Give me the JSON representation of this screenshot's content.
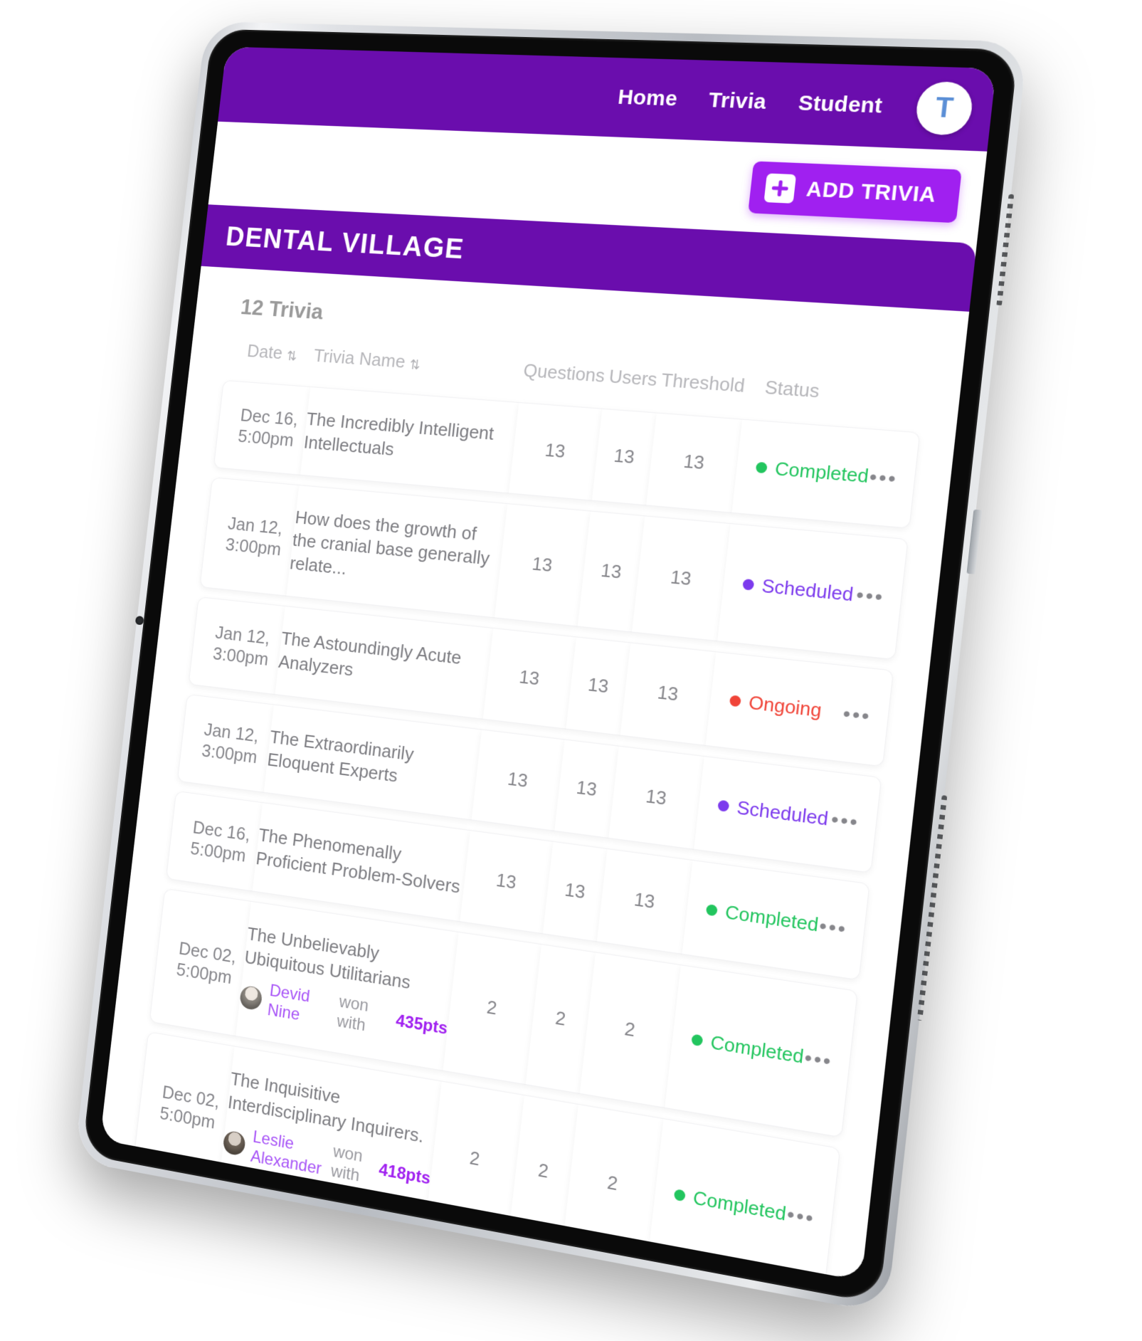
{
  "app": {
    "brand_purple": "#6a0dad",
    "accent_purple": "#a020f0",
    "title": "DENTAL VILLAGE"
  },
  "topbar": {
    "nav": [
      {
        "label": "Home"
      },
      {
        "label": "Trivia"
      },
      {
        "label": "Student"
      }
    ],
    "avatar_initial": "T"
  },
  "actions": {
    "add_trivia_label": "ADD TRIVIA",
    "add_icon": "plus-icon"
  },
  "list": {
    "count_label": "12 Trivia",
    "columns": [
      {
        "key": "date",
        "label": "Date",
        "sortable": true
      },
      {
        "key": "name",
        "label": "Trivia Name",
        "sortable": true
      },
      {
        "key": "questions",
        "label": "Questions",
        "sortable": false
      },
      {
        "key": "users",
        "label": "Users",
        "sortable": false
      },
      {
        "key": "threshold",
        "label": "Threshold",
        "sortable": false
      },
      {
        "key": "status",
        "label": "Status",
        "sortable": false
      }
    ],
    "sort_glyph": "⇅",
    "kebab_glyph": "•••",
    "status_colors": {
      "Completed": "#22c55e",
      "Scheduled": "#7c3aed",
      "Ongoing": "#f04438"
    },
    "rows": [
      {
        "date": "Dec 16, 5:00pm",
        "name": "The Incredibly Intelligent Intellectuals",
        "questions": "13",
        "users": "13",
        "threshold": "13",
        "status": "Completed",
        "winner": null
      },
      {
        "date": "Jan 12, 3:00pm",
        "name": "How does the growth of the cranial base generally relate...",
        "questions": "13",
        "users": "13",
        "threshold": "13",
        "status": "Scheduled",
        "winner": null
      },
      {
        "date": "Jan 12, 3:00pm",
        "name": "The Astoundingly Acute Analyzers",
        "questions": "13",
        "users": "13",
        "threshold": "13",
        "status": "Ongoing",
        "winner": null
      },
      {
        "date": "Jan 12, 3:00pm",
        "name": "The Extraordinarily Eloquent Experts",
        "questions": "13",
        "users": "13",
        "threshold": "13",
        "status": "Scheduled",
        "winner": null
      },
      {
        "date": "Dec 16, 5:00pm",
        "name": "The Phenomenally Proficient Problem-Solvers",
        "questions": "13",
        "users": "13",
        "threshold": "13",
        "status": "Completed",
        "winner": null
      },
      {
        "date": "Dec 02, 5:00pm",
        "name": "The Unbelievably Ubiquitous Utilitarians",
        "questions": "2",
        "users": "2",
        "threshold": "2",
        "status": "Completed",
        "winner": {
          "name": "Devid Nine",
          "mid": "won with",
          "points": "435pts"
        }
      },
      {
        "date": "Dec 02, 5:00pm",
        "name": "The Inquisitive Interdisciplinary Inquirers.",
        "questions": "2",
        "users": "2",
        "threshold": "2",
        "status": "Completed",
        "winner": {
          "name": "Leslie Alexander",
          "mid": "won with",
          "points": "418pts"
        }
      }
    ]
  }
}
